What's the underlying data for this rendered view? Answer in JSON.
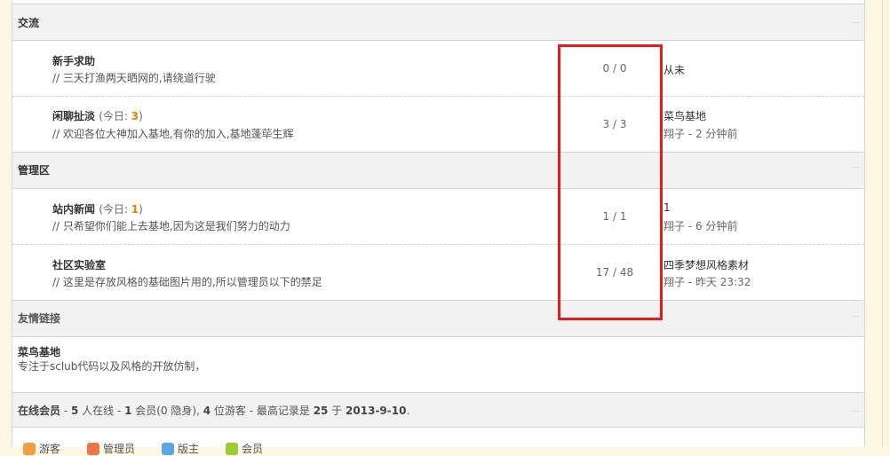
{
  "categories": [
    {
      "title": "交流"
    },
    {
      "title": "管理区"
    },
    {
      "title": "友情链接"
    }
  ],
  "forums": [
    {
      "name": "新手求助",
      "today_label": "",
      "today_count": "",
      "desc": "// 三天打渔两天晒网的,请绕道行驶",
      "counts": "0 / 0",
      "last_title": "从未",
      "last_meta": ""
    },
    {
      "name": "闲聊扯淡",
      "today_label": "(今日: ",
      "today_count": "3",
      "today_close": ")",
      "desc": "// 欢迎各位大神加入基地,有你的加入,基地蓬荜生辉",
      "counts": "3 / 3",
      "last_title": "菜鸟基地",
      "last_meta": "翔子 - 2 分钟前"
    },
    {
      "name": "站内新闻",
      "today_label": "(今日: ",
      "today_count": "1",
      "today_close": ")",
      "desc": "// 只希望你们能上去基地,因为这是我们努力的动力",
      "counts": "1 / 1",
      "last_title": "1",
      "last_meta": "翔子 - 6 分钟前"
    },
    {
      "name": "社区实验室",
      "today_label": "",
      "today_count": "",
      "desc": "// 这里是存放风格的基础图片用的,所以管理员以下的禁足",
      "counts": "17 / 48",
      "last_title": "四季梦想风格素材",
      "last_meta": "翔子 - 昨天 23:32"
    }
  ],
  "link": {
    "title": "菜鸟基地",
    "desc": "专注于sclub代码以及风格的开放仿制，"
  },
  "online": {
    "label": "在线会员",
    "s1": " - ",
    "total": "5",
    "s2": " 人在线 - ",
    "members": "1",
    "s3": " 会员(0 隐身), ",
    "guests": "4",
    "s4": " 位游客 - 最高记录是 ",
    "record": "25",
    "s5": " 于 ",
    "record_date": "2013-9-10",
    "s6": "."
  },
  "legend": [
    {
      "label": "游客",
      "color": "#f0a040"
    },
    {
      "label": "管理员",
      "color": "#e8784a"
    },
    {
      "label": "版主",
      "color": "#5aa6e0"
    },
    {
      "label": "会员",
      "color": "#9acd32"
    }
  ],
  "colors": {
    "highlight": "#e41c1c",
    "today_count": "#e67e00"
  }
}
